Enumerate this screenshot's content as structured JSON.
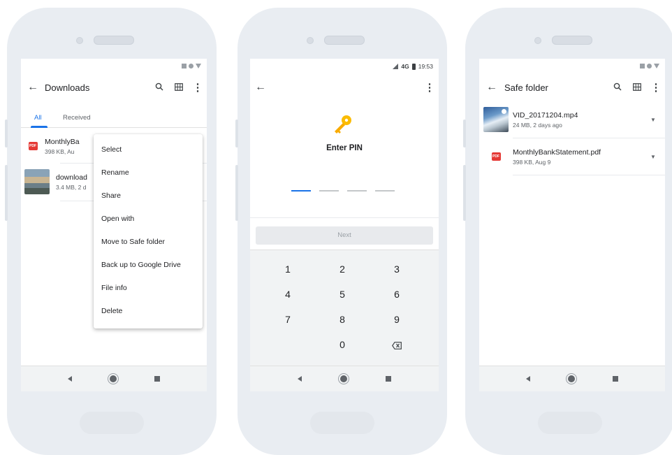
{
  "phone1": {
    "title": "Downloads",
    "tabs": [
      "All",
      "Received"
    ],
    "files": [
      {
        "name": "MonthlyBa",
        "meta": "398 KB, Au",
        "icon_label": "PDF"
      },
      {
        "name": "download",
        "meta": "3.4 MB, 2 d"
      }
    ],
    "menu": [
      "Select",
      "Rename",
      "Share",
      "Open with",
      "Move to Safe folder",
      "Back up to Google Drive",
      "File info",
      "Delete"
    ]
  },
  "phone2": {
    "status": {
      "network": "4G",
      "time": "19:53"
    },
    "pin_title": "Enter PIN",
    "next_label": "Next",
    "keys": [
      "1",
      "2",
      "3",
      "4",
      "5",
      "6",
      "7",
      "8",
      "9",
      "0"
    ],
    "key_color": "#fbbc04",
    "accent": "#1a73e8"
  },
  "phone3": {
    "title": "Safe folder",
    "files": [
      {
        "name": "VID_20171204.mp4",
        "meta": "24 MB, 2 days ago"
      },
      {
        "name": "MonthlyBankStatement.pdf",
        "meta": "398 KB, Aug 9",
        "icon_label": "PDF"
      }
    ]
  },
  "icons": {
    "back": "←",
    "search": "⌕",
    "grid": "⊞",
    "more": "⋮",
    "chevron": "▼",
    "backspace": "⌫"
  }
}
